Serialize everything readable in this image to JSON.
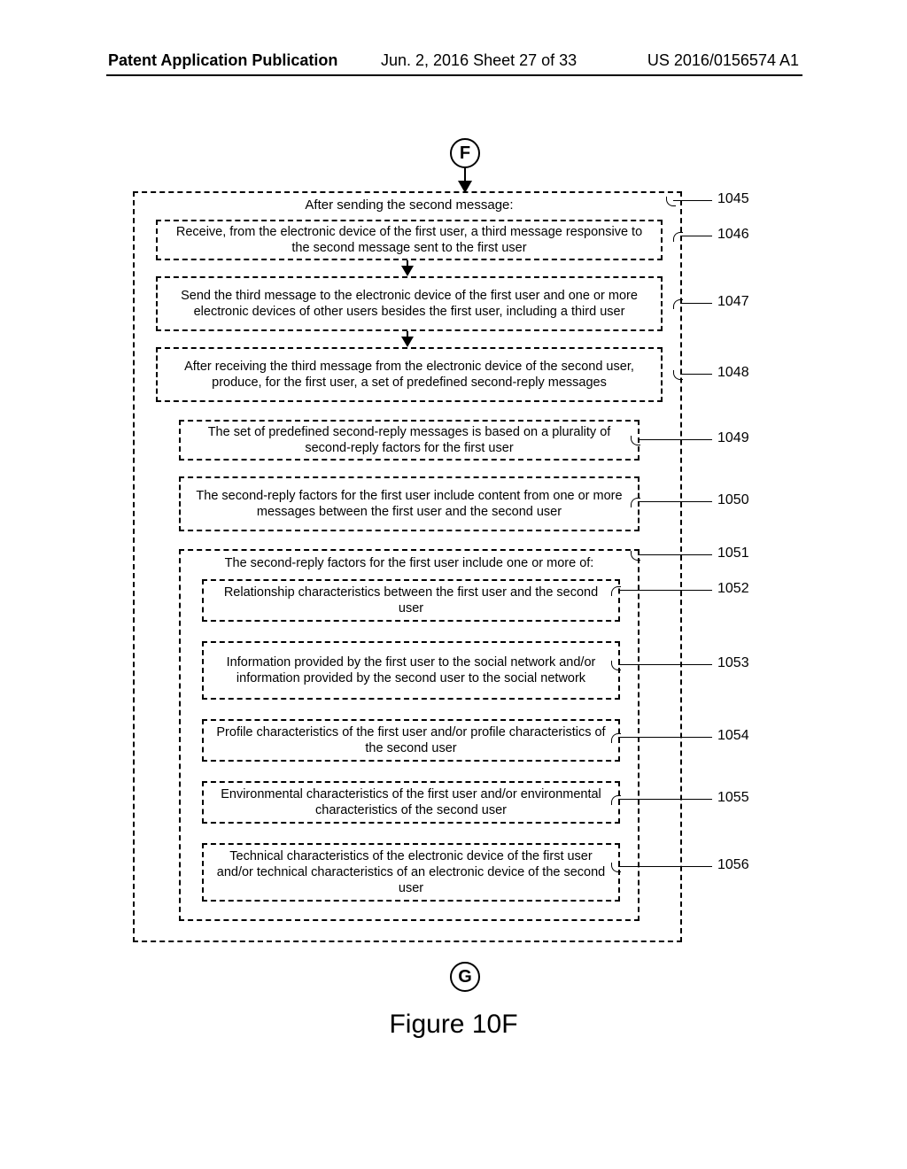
{
  "header": {
    "left": "Patent Application Publication",
    "mid": "Jun. 2, 2016  Sheet 27 of 33",
    "right": "US 2016/0156574 A1"
  },
  "connectors": {
    "top": "F",
    "bottom": "G"
  },
  "figure_caption": "Figure 10F",
  "boxes": {
    "b1045": "After sending the second message:",
    "b1046": "Receive, from the electronic device of the first user, a third message responsive to the second message sent to the first user",
    "b1047": "Send the third message to the electronic device of the first user and one or more electronic devices of other users besides the first user, including a third user",
    "b1048": "After receiving the third message from the electronic device of the second user, produce, for the first user, a set of predefined second-reply messages",
    "b1049": "The set of predefined second-reply messages is based on a plurality of second-reply factors for the first user",
    "b1050": "The second-reply factors for the first user include content from one or more messages between the first user and the second user",
    "b1051_title": "The second-reply factors for the first user include one or more of:",
    "b1052": "Relationship characteristics between the first user and the second user",
    "b1053": "Information provided by the first user to the social network and/or information provided by the second user to the social network",
    "b1054": "Profile characteristics of the first user and/or profile characteristics of the second user",
    "b1055": "Environmental characteristics of the first user and/or environmental characteristics of the second user",
    "b1056": "Technical characteristics of the electronic device of the first user and/or technical characteristics of an electronic device of the second user"
  },
  "labels": {
    "l1045": "1045",
    "l1046": "1046",
    "l1047": "1047",
    "l1048": "1048",
    "l1049": "1049",
    "l1050": "1050",
    "l1051": "1051",
    "l1052": "1052",
    "l1053": "1053",
    "l1054": "1054",
    "l1055": "1055",
    "l1056": "1056"
  }
}
